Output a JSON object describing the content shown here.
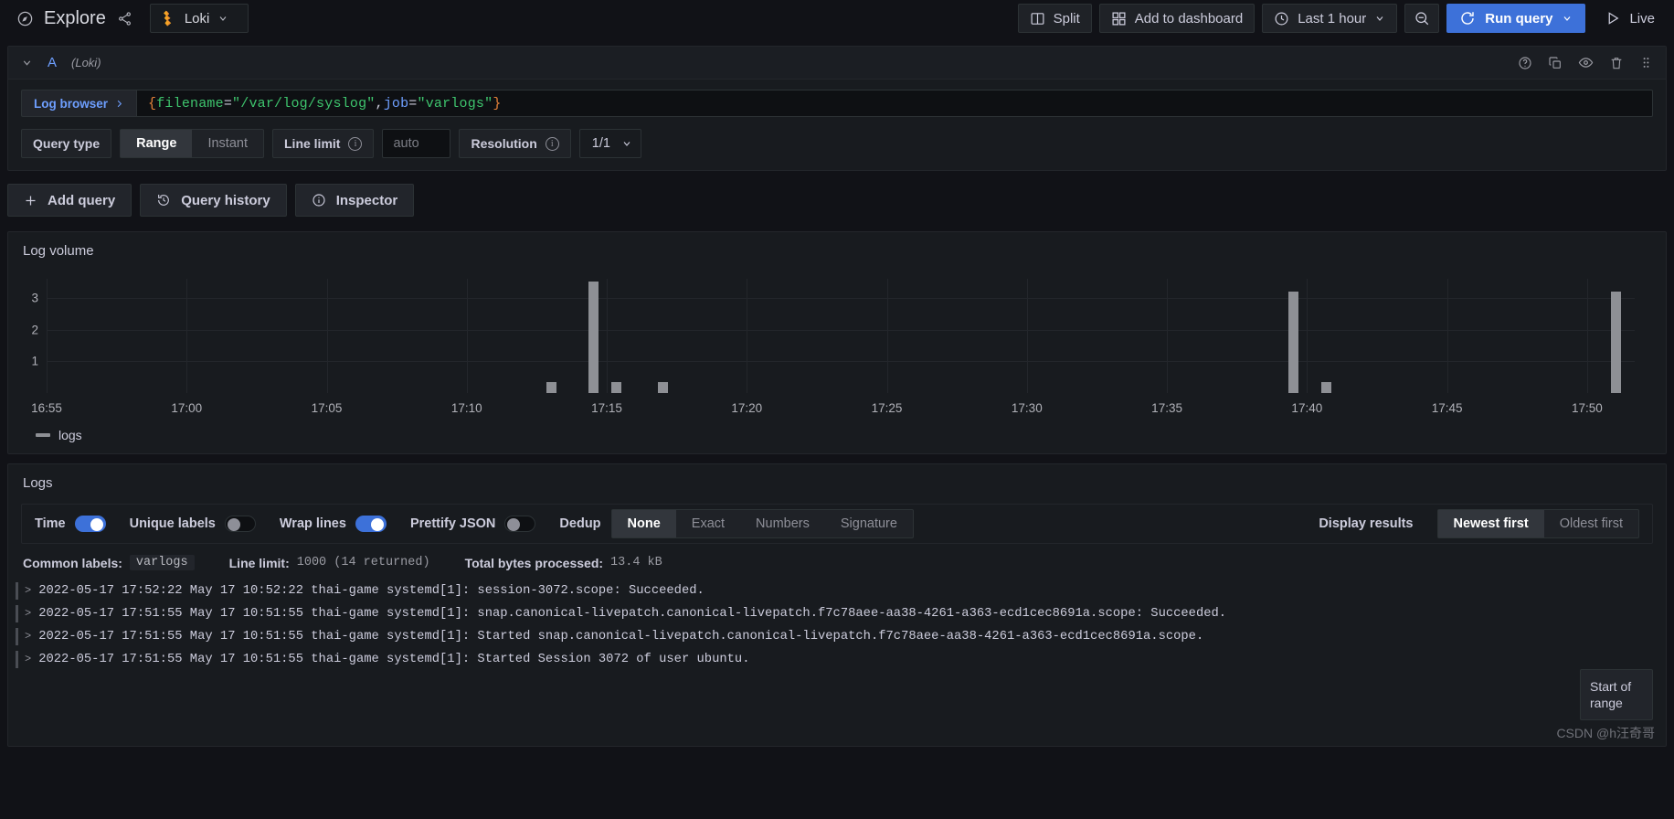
{
  "topbar": {
    "title": "Explore",
    "share_icon": "share-icon",
    "compass_icon": "compass-icon",
    "datasource": {
      "name": "Loki",
      "logo_icon": "loki-logo-icon",
      "chevron": "chevron-down-icon"
    },
    "split_label": "Split",
    "add_to_dashboard_label": "Add to dashboard",
    "time_range_label": "Last 1 hour",
    "zoom_out_icon": "zoom-out-icon",
    "run_query_label": "Run query",
    "live_label": "Live"
  },
  "query": {
    "ref_id": "A",
    "datasource_note": "(Loki)",
    "log_browser_label": "Log browser",
    "expr_tokens": [
      {
        "t": "{",
        "c": "brace"
      },
      {
        "t": "filename",
        "c": "str"
      },
      {
        "t": "=",
        "c": "op"
      },
      {
        "t": "\"/var/log/syslog\"",
        "c": "str"
      },
      {
        "t": ",",
        "c": "comma"
      },
      {
        "t": "job",
        "c": "label"
      },
      {
        "t": "=",
        "c": "op"
      },
      {
        "t": "\"varlogs\"",
        "c": "str"
      },
      {
        "t": "}",
        "c": "brace"
      }
    ],
    "options": {
      "query_type_label": "Query type",
      "query_type_options": [
        "Range",
        "Instant"
      ],
      "query_type_selected": "Range",
      "line_limit_label": "Line limit",
      "line_limit_placeholder": "auto",
      "line_limit_value": "",
      "resolution_label": "Resolution",
      "resolution_value": "1/1"
    },
    "actions": {
      "add_query": "Add query",
      "query_history": "Query history",
      "inspector": "Inspector"
    },
    "header_icons": [
      "help-circle-icon",
      "copy-icon",
      "eye-icon",
      "trash-icon",
      "drag-handle-icon"
    ]
  },
  "log_volume": {
    "title": "Log volume",
    "legend_label": "logs"
  },
  "chart_data": {
    "type": "bar",
    "title": "Log volume",
    "xlabel": "",
    "ylabel": "",
    "ylim": [
      0,
      3.6
    ],
    "yticks": [
      1,
      2,
      3
    ],
    "grid": true,
    "legend": [
      {
        "name": "logs",
        "color": "#8e9095"
      }
    ],
    "xticks": [
      "16:55",
      "17:00",
      "17:05",
      "17:10",
      "17:15",
      "17:20",
      "17:25",
      "17:30",
      "17:35",
      "17:40",
      "17:45",
      "17:50"
    ],
    "series": [
      {
        "name": "logs",
        "color": "#8e9095",
        "points": [
          {
            "x": "17:13",
            "value": 0.35
          },
          {
            "x": "17:14:30",
            "value": 3.5
          },
          {
            "x": "17:15:20",
            "value": 0.35
          },
          {
            "x": "17:17",
            "value": 0.35
          },
          {
            "x": "17:39:30",
            "value": 3.2
          },
          {
            "x": "17:40:40",
            "value": 0.35
          },
          {
            "x": "17:51",
            "value": 3.2
          }
        ]
      }
    ]
  },
  "logs": {
    "title": "Logs",
    "toggles": [
      {
        "label": "Time",
        "on": true
      },
      {
        "label": "Unique labels",
        "on": false
      },
      {
        "label": "Wrap lines",
        "on": true
      },
      {
        "label": "Prettify JSON",
        "on": false
      }
    ],
    "dedup_label": "Dedup",
    "dedup_options": [
      "None",
      "Exact",
      "Numbers",
      "Signature"
    ],
    "dedup_selected": "None",
    "display_results_label": "Display results",
    "order_options": [
      "Newest first",
      "Oldest first"
    ],
    "order_selected": "Newest first",
    "meta": {
      "common_labels_key": "Common labels:",
      "common_labels_value": "varlogs",
      "line_limit_key": "Line limit:",
      "line_limit_value": "1000 (14 returned)",
      "bytes_key": "Total bytes processed:",
      "bytes_value": "13.4 kB"
    },
    "rows": [
      "2022-05-17 17:52:22 May 17 10:52:22 thai-game systemd[1]: session-3072.scope: Succeeded.",
      "2022-05-17 17:51:55 May 17 10:51:55 thai-game systemd[1]: snap.canonical-livepatch.canonical-livepatch.f7c78aee-aa38-4261-a363-ecd1cec8691a.scope: Succeeded.",
      "2022-05-17 17:51:55 May 17 10:51:55 thai-game systemd[1]: Started snap.canonical-livepatch.canonical-livepatch.f7c78aee-aa38-4261-a363-ecd1cec8691a.scope.",
      "2022-05-17 17:51:55 May 17 10:51:55 thai-game systemd[1]: Started Session 3072 of user ubuntu."
    ],
    "range_hint": "Start of range",
    "watermark": "CSDN @h汪奇哥"
  }
}
